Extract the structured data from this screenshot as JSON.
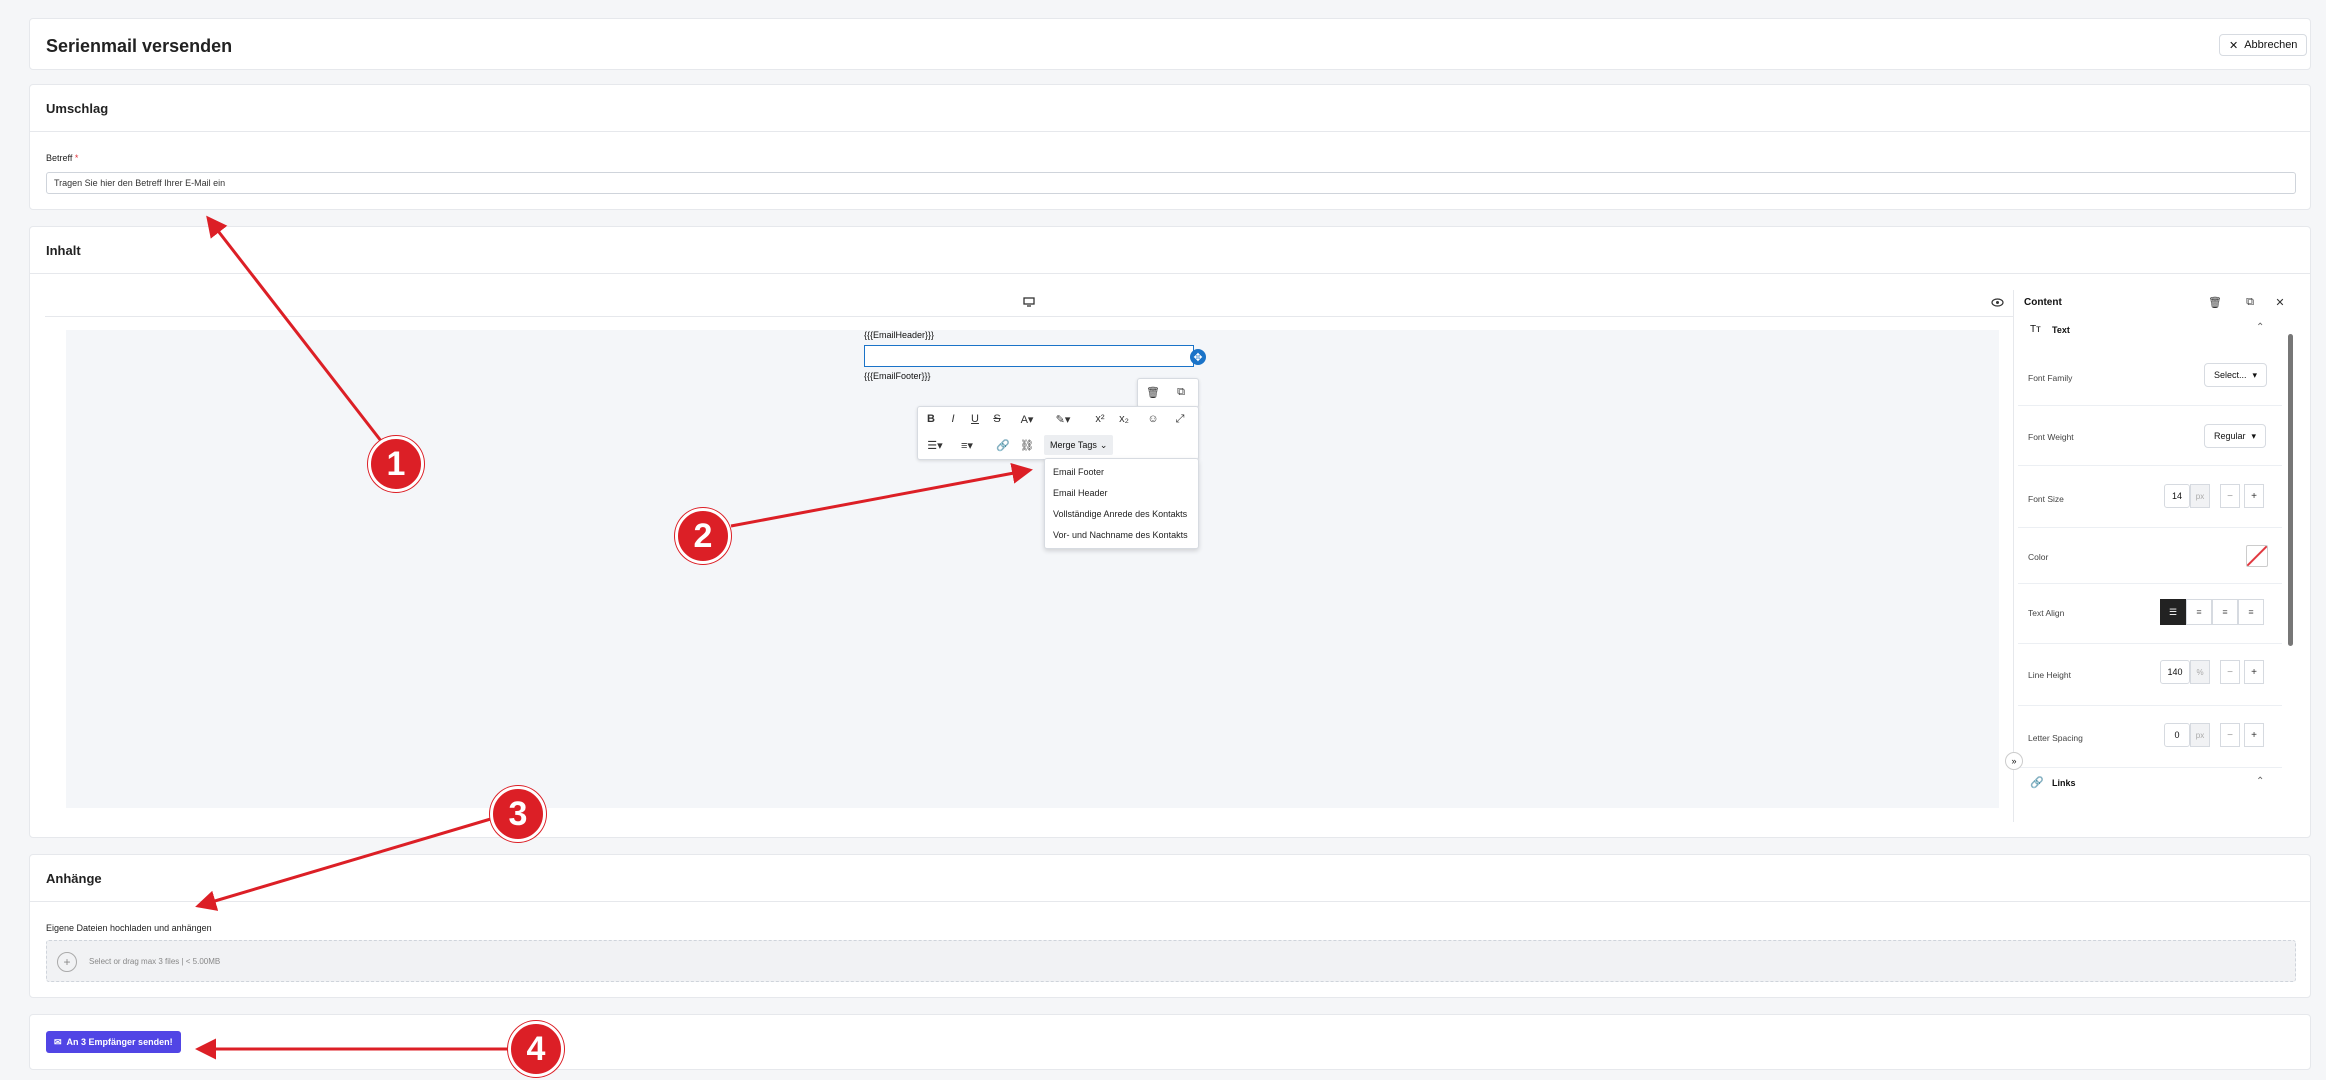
{
  "header": {
    "title": "Serienmail versenden",
    "cancel_label": "Abbrechen"
  },
  "envelope": {
    "title": "Umschlag",
    "subject_label": "Betreff",
    "subject_required_mark": "*",
    "subject_value": "Tragen Sie hier den Betreff Ihrer E-Mail ein"
  },
  "content": {
    "title": "Inhalt",
    "editor": {
      "header_tag": "{{{EmailHeader}}}",
      "footer_tag": "{{{EmailFooter}}}",
      "merge_tags_label": "Merge Tags",
      "merge_tags_options": [
        "Email Footer",
        "Email Header",
        "Vollständige Anrede des Kontakts",
        "Vor- und Nachname des Kontakts"
      ]
    },
    "panel": {
      "title": "Content",
      "text_section": "Text",
      "font_family_label": "Font Family",
      "font_family_value": "Select...",
      "font_weight_label": "Font Weight",
      "font_weight_value": "Regular",
      "font_size_label": "Font Size",
      "font_size_value": "14",
      "font_size_unit": "px",
      "color_label": "Color",
      "text_align_label": "Text Align",
      "line_height_label": "Line Height",
      "line_height_value": "140",
      "line_height_unit": "%",
      "letter_spacing_label": "Letter Spacing",
      "letter_spacing_value": "0",
      "letter_spacing_unit": "px",
      "links_section": "Links"
    }
  },
  "attachments": {
    "title": "Anhänge",
    "upload_label": "Eigene Dateien hochladen und anhängen",
    "upload_hint": "Select or drag max 3 files | < 5.00MB"
  },
  "footer": {
    "send_label": "An 3 Empfänger senden!"
  },
  "annotations": [
    "1",
    "2",
    "3",
    "4"
  ],
  "colors": {
    "accent": "#5145e5",
    "annotation": "#dc1f26",
    "editor_focus": "#1a73c8"
  }
}
